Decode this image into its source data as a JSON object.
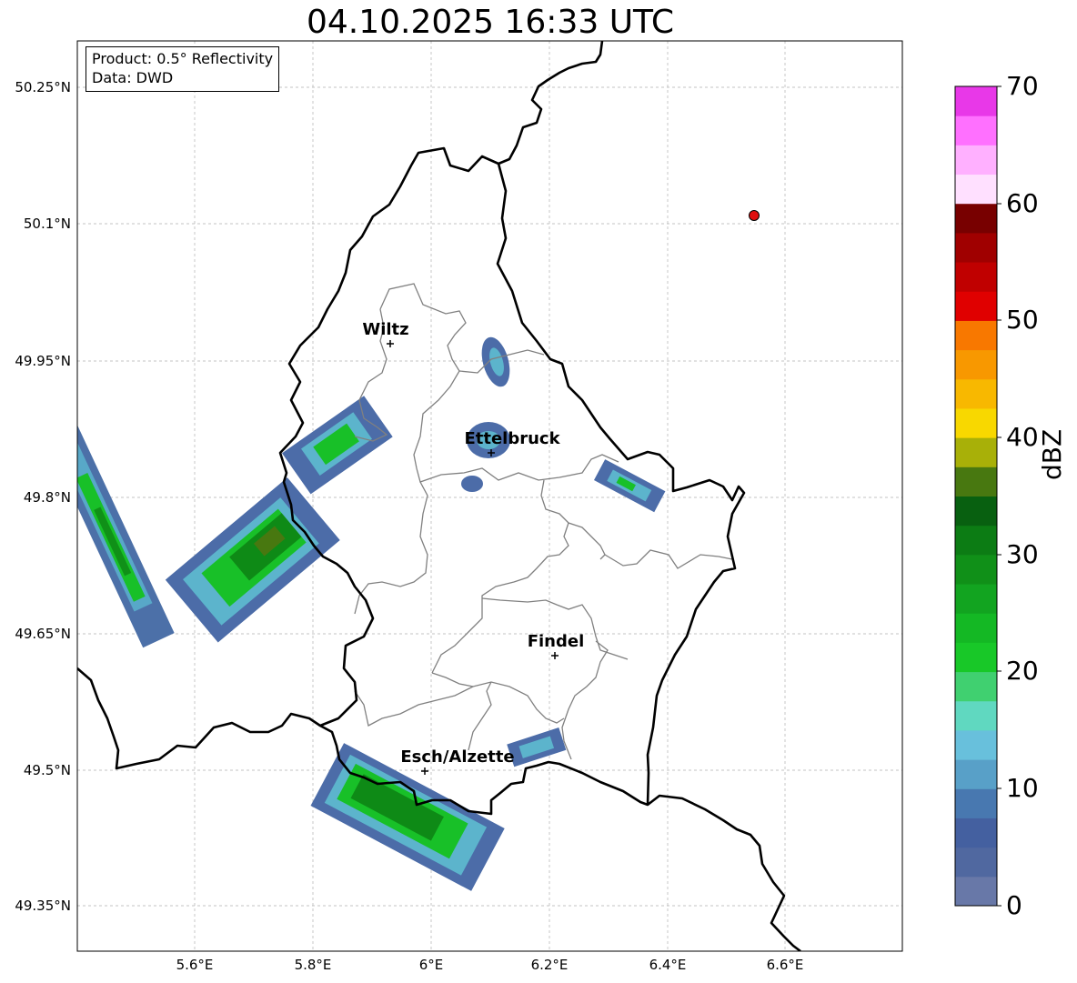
{
  "title": "04.10.2025 16:33 UTC",
  "info": {
    "product": "Product: 0.5° Reflectivity",
    "data": "Data: DWD"
  },
  "axes": {
    "lat_ticks": [
      "50.25°N",
      "50.1°N",
      "49.95°N",
      "49.8°N",
      "49.65°N",
      "49.5°N",
      "49.35°N"
    ],
    "lon_ticks": [
      "5.6°E",
      "5.8°E",
      "6°E",
      "6.2°E",
      "6.4°E",
      "6.6°E"
    ],
    "gridlines": true
  },
  "cities": [
    {
      "name": "Wiltz"
    },
    {
      "name": "Ettelbruck"
    },
    {
      "name": "Findel"
    },
    {
      "name": "Esch/Alzette"
    }
  ],
  "radar_site_marker": {
    "color": "#e01010"
  },
  "colorbar": {
    "label": "dBZ",
    "ticks": [
      "0",
      "10",
      "20",
      "30",
      "40",
      "50",
      "60",
      "70"
    ],
    "range": [
      0,
      70
    ],
    "step": 2.5,
    "colors": [
      "#6878a8",
      "#5068a0",
      "#4460a0",
      "#4878b0",
      "#58a0c8",
      "#68c0dc",
      "#60d8c0",
      "#40d070",
      "#18c828",
      "#14b824",
      "#12a420",
      "#109018",
      "#0c7c14",
      "#086010",
      "#487810",
      "#a8b008",
      "#f8d800",
      "#f8b800",
      "#f89800",
      "#f87800",
      "#e00000",
      "#c00000",
      "#a00000",
      "#780000",
      "#ffe0ff",
      "#ffb0ff",
      "#ff70ff",
      "#e838e8"
    ]
  }
}
